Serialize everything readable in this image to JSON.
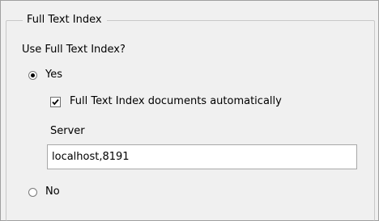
{
  "group": {
    "title": "Full Text Index"
  },
  "question": {
    "label": "Use Full Text Index?"
  },
  "options": {
    "yes": {
      "label": "Yes",
      "selected": true
    },
    "no": {
      "label": "No",
      "selected": false
    }
  },
  "auto_index": {
    "label": "Full Text Index documents automatically",
    "checked": true
  },
  "server": {
    "label": "Server",
    "value": "localhost,8191"
  }
}
